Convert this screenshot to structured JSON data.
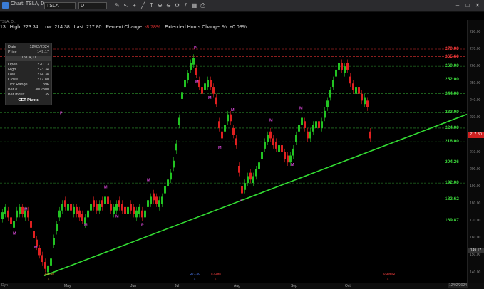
{
  "window": {
    "title": "Chart: TSLA, D",
    "symbol": "TSLA",
    "interval": "D",
    "icons": [
      "chart-app-icon",
      "symbol-dropdown-icon",
      "interval-dropdown-icon",
      "draw-icon",
      "cursor-icon",
      "tool-icons",
      "window-minimize-icon",
      "window-maximize-icon",
      "window-close-icon"
    ]
  },
  "status": {
    "row_label": "13",
    "high_label": "High",
    "high_value": "223.34",
    "low_label": "Low",
    "low_value": "214.38",
    "last_label": "Last",
    "last_value": "217.80",
    "pct_label": "Percent Change",
    "pct_value": "-8.78%",
    "ext_label": "Extended Hours Change, %",
    "ext_value": "+0.08%"
  },
  "subheader": "TSLA, D...",
  "info": {
    "date_label": "Date",
    "date_value": "12/02/2024",
    "price_label": "Price",
    "price_value": "149.17",
    "symbol": "TSLA, D",
    "open_label": "Open",
    "open_value": "220.13",
    "high_label": "High",
    "high_value": "223.34",
    "low_label": "Low",
    "low_value": "214.38",
    "close_label": "Close",
    "close_value": "217.80",
    "tick_label": "Tick Range",
    "tick_value": "896",
    "bar_label": "Bar #",
    "bar_value": "300/300",
    "index_label": "Bar Index",
    "index_value": "35",
    "pivots_button": "GET Pivots"
  },
  "levels": [
    {
      "label": "270.00",
      "color": "red"
    },
    {
      "label": "265.60",
      "color": "red"
    },
    {
      "label": "260.00",
      "color": "green"
    },
    {
      "label": "252.00",
      "color": "green"
    },
    {
      "label": "244.00",
      "color": "green"
    },
    {
      "label": "233.00",
      "color": "green"
    },
    {
      "label": "224.00",
      "color": "green"
    },
    {
      "label": "216.00",
      "color": "green"
    },
    {
      "label": "204.26",
      "color": "green"
    },
    {
      "label": "192.00",
      "color": "green"
    },
    {
      "label": "182.62",
      "color": "green"
    },
    {
      "label": "169.87",
      "color": "green"
    }
  ],
  "axis_ticks": [
    "280.00",
    "270.00",
    "260.00",
    "250.00",
    "240.00",
    "230.00",
    "220.00",
    "210.00",
    "200.00",
    "190.00",
    "180.00",
    "170.00",
    "160.00",
    "150.00",
    "140.00"
  ],
  "price_tag": "217.80",
  "price_tag2": "149.17",
  "x_labels": [
    "May",
    "Jun",
    "Jul",
    "Aug",
    "Sep",
    "Oct"
  ],
  "bottom": {
    "dyn_label": "Dyn",
    "date_chip": "12/02/2024",
    "note_year": "2024"
  },
  "markers": {
    "p": "P",
    "m": "M",
    "annot1": "138.80",
    "annot2": "271.00",
    "annot3": "5.4298",
    "annot4": "0.398827"
  },
  "colors": {
    "up": "#22c322",
    "down": "#e02020",
    "trend": "#33dd33",
    "red_level": "#e03030",
    "green_level": "#2f9a2f",
    "marker": "#cc44cc"
  }
}
